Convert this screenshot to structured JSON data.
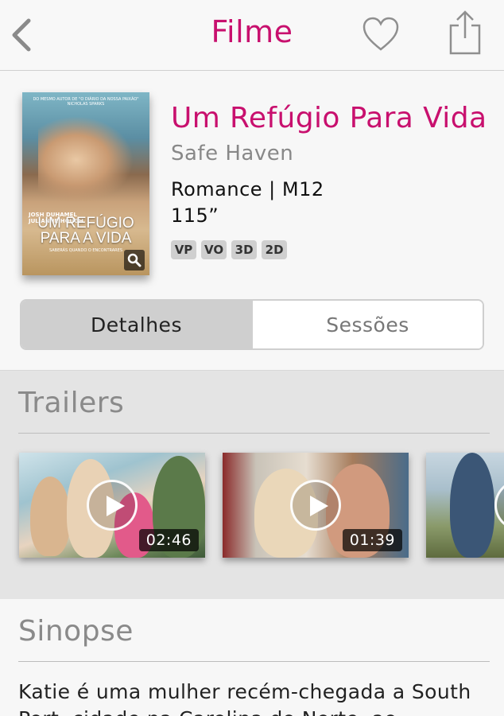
{
  "navbar": {
    "title": "Filme",
    "back_icon": "chevron-left-icon",
    "favorite_icon": "heart-icon",
    "share_icon": "share-icon"
  },
  "movie": {
    "title": "Um Refúgio Para Vida",
    "original_title": "Safe Haven",
    "genre_rating": "Romance | M12",
    "duration": "115”",
    "badges": [
      "VP",
      "VO",
      "3D",
      "2D"
    ],
    "poster": {
      "top_text": "DO MESMO AUTOR DE \"O DIÁRIO DA NOSSA PAIXÃO\" NICHOLAS SPARKS",
      "actors": [
        "JOSH DUHAMEL",
        "JULIANNE HOUGH"
      ],
      "title_line1": "UM REFÚGIO",
      "title_line2": "PARA A VIDA",
      "tagline": "SABERÁS QUANDO O ENCONTRARES"
    }
  },
  "tabs": {
    "details": "Detalhes",
    "sessions": "Sessões",
    "active": "details"
  },
  "trailers": {
    "title": "Trailers",
    "items": [
      {
        "duration": "02:46"
      },
      {
        "duration": "01:39"
      },
      {
        "duration": ""
      }
    ]
  },
  "synopsis": {
    "title": "Sinopse",
    "text": "Katie é uma mulher recém-chegada a South Port, cidade na Carolina do Norte, ao ..."
  },
  "colors": {
    "accent": "#c8106e",
    "nav_bg": "#f8f8f8",
    "trailers_bg": "#e4e4e4",
    "segment_active": "#cfcfcf"
  }
}
